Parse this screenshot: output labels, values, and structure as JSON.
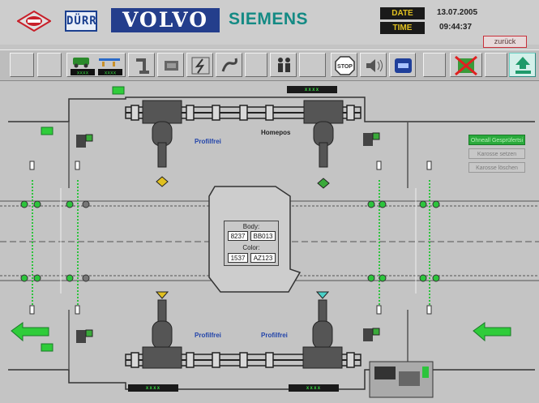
{
  "header": {
    "brand_eisenmann": "EISENMANN",
    "brand_durr": "DÜRR",
    "brand_volvo": "VOLVO",
    "brand_siemens": "SIEMENS",
    "date_label": "DATE",
    "date_value": "13.07.2005",
    "time_label": "TIME",
    "time_value": "09:44:37",
    "back_label": "zurück"
  },
  "toolbar": {
    "icons": [
      "empty-slot",
      "empty-slot",
      "vehicle-status-icon",
      "robot-arm-icon",
      "control-cabinet-icon",
      "lightning-icon",
      "hose-icon",
      "empty-slot",
      "operator-icon",
      "empty-slot",
      "stop-icon",
      "horn-icon",
      "conveyor-icon",
      "empty-slot",
      "bypass-icon",
      "empty-slot",
      "lift-icon"
    ],
    "status_fields": [
      "xxxx",
      "xxxx"
    ]
  },
  "plant": {
    "counter_top": "xxxx",
    "counter_bottom_left": "xxxx",
    "counter_bottom_right": "xxxx",
    "profil_top_left": "Profilfrei",
    "homepos": "Homepos",
    "profil_bottom_left": "Profilfrei",
    "profil_bottom_right": "Profilfrei",
    "station_buttons": [
      "Ohneall Gesprüfertsi",
      "Karosse setzen",
      "Karosse löschen"
    ],
    "body_panel": {
      "body_title": "Body:",
      "body_left": "8237",
      "body_right": "BB013",
      "color_title": "Color:",
      "color_left": "1537",
      "color_right": "AZ123"
    }
  },
  "colors": {
    "signal_green": "#2cc43c",
    "arrow_green": "#2fcc3a",
    "counter_bg": "#1a1a1a",
    "label_blue": "#2244aa"
  }
}
